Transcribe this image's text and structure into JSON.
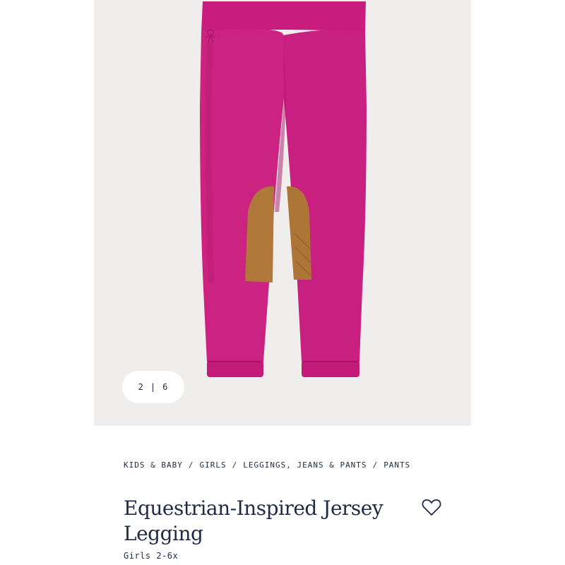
{
  "gallery": {
    "current": "2",
    "separator": "|",
    "total": "6"
  },
  "breadcrumb": {
    "items": [
      "KIDS & BABY",
      "GIRLS",
      "LEGGINGS, JEANS & PANTS",
      "PANTS"
    ],
    "separator": "/"
  },
  "product": {
    "title": "Equestrian-Inspired Jersey Legging",
    "subtitle": "Girls 2-6x",
    "color": "#c91e7f",
    "patch_color": "#b0783a"
  },
  "icons": {
    "wishlist": "heart-outline-icon"
  }
}
